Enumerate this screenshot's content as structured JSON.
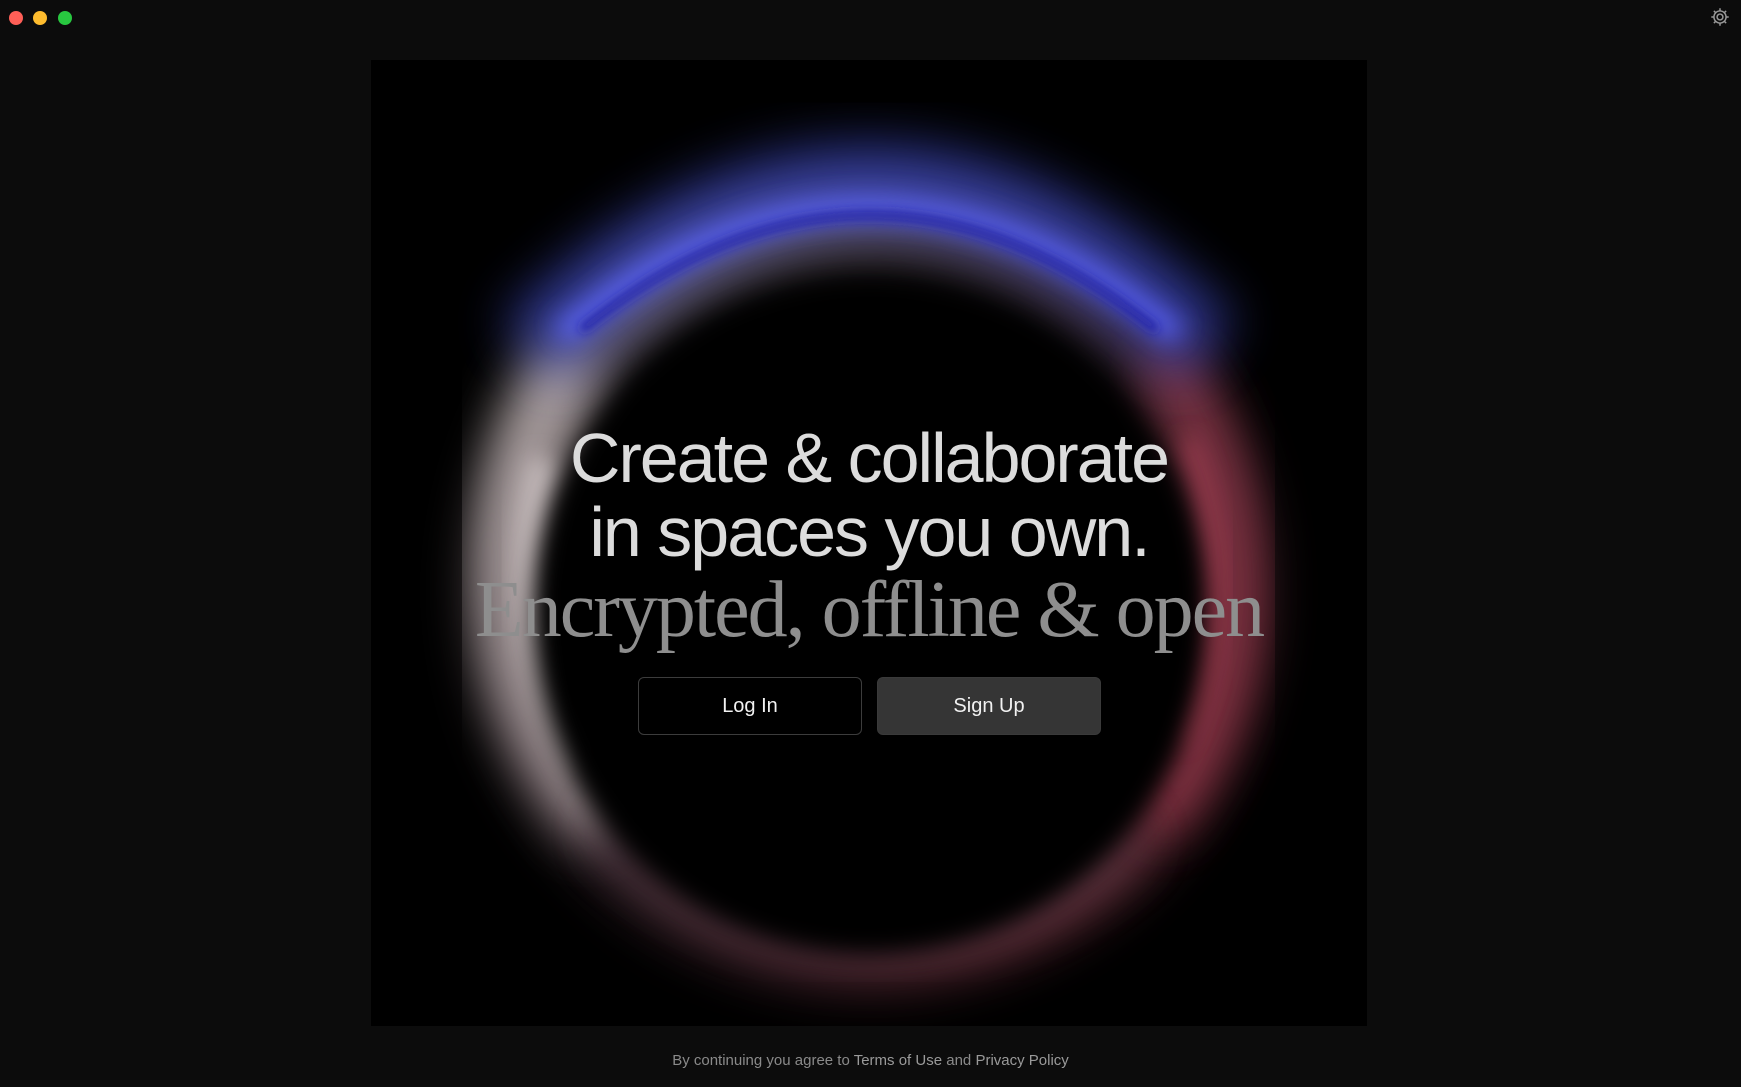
{
  "window": {
    "controls": [
      "close",
      "minimize",
      "maximize"
    ],
    "settings_icon": "gear-icon"
  },
  "hero": {
    "headline_line1": "Create & collaborate",
    "headline_line2": "in spaces you own.",
    "tagline": "Encrypted, offline & open"
  },
  "actions": {
    "login_label": "Log In",
    "signup_label": "Sign Up"
  },
  "footer": {
    "prefix": "By continuing you agree to ",
    "terms_label": "Terms of Use",
    "conjunction": " and ",
    "privacy_label": "Privacy Policy"
  },
  "colors": {
    "background": "#0c0c0c",
    "stage": "#000000",
    "ring_top": "#3a3fd8",
    "ring_left": "#d8c8c8",
    "ring_right": "#b04a5a",
    "signup_button": "#353535",
    "close": "#ff5f57",
    "minimize": "#febc2e",
    "maximize": "#28c840"
  }
}
